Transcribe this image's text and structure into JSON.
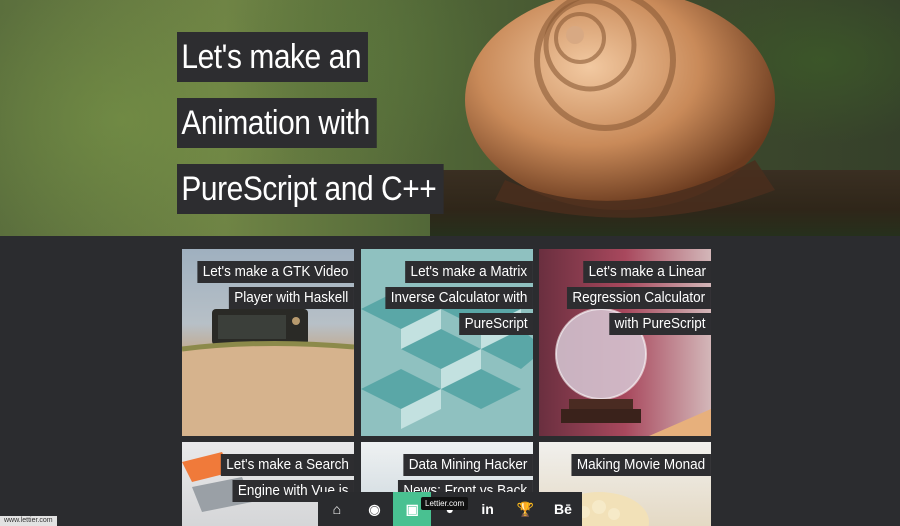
{
  "hero": {
    "title_lines": [
      "Let's make an",
      "Animation with",
      "PureScript and C++"
    ]
  },
  "cards": [
    {
      "lines": [
        "Let's make a GTK Video",
        "Player with Haskell"
      ]
    },
    {
      "lines": [
        "Let's make a Matrix",
        "Inverse Calculator with",
        "PureScript"
      ]
    },
    {
      "lines": [
        "Let's make a Linear",
        "Regression Calculator",
        "with PureScript"
      ]
    },
    {
      "lines": [
        "Let's make a Search",
        "Engine with Vue.js"
      ]
    },
    {
      "lines": [
        "Data Mining Hacker",
        "News: Front vs Back"
      ]
    },
    {
      "lines": [
        "Making Movie Monad"
      ]
    }
  ],
  "bottom_nav": {
    "items": [
      {
        "icon": "home-icon",
        "glyph": "⌂"
      },
      {
        "icon": "rss-icon",
        "glyph": "◉"
      },
      {
        "icon": "logo-icon",
        "glyph": "▣",
        "active": true
      },
      {
        "icon": "github-icon",
        "glyph": "●"
      },
      {
        "icon": "linkedin-icon",
        "glyph": "in"
      },
      {
        "icon": "trophy-icon",
        "glyph": "🏆"
      },
      {
        "icon": "behance-icon",
        "glyph": "Bē"
      }
    ],
    "tooltip": "Lettier.com"
  },
  "status": {
    "url": "www.lettier.com"
  },
  "colors": {
    "accent": "#49c191",
    "label_bg": "#2d2d30",
    "page_bg": "#2b2c2f"
  }
}
